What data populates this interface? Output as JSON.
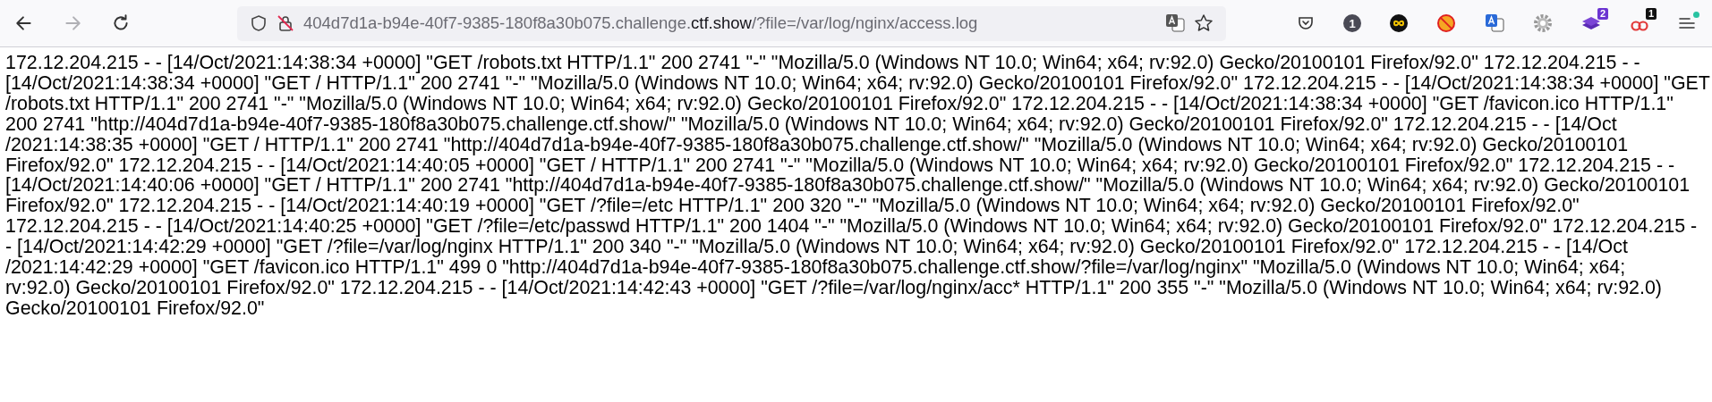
{
  "navigation": [
    {
      "kind": "back",
      "disabled": false
    },
    {
      "kind": "forward",
      "disabled": true
    },
    {
      "kind": "reload",
      "disabled": false
    }
  ],
  "address_bar": {
    "url_host": "404d7d1a-b94e-40f7-9385-180f8a30b075.challenge.",
    "url_domain": "ctf.show",
    "url_path": "/?file=/var/log/nginx/access.log"
  },
  "toolbar_icons": [
    {
      "kind": "pocket"
    },
    {
      "kind": "counter",
      "text": "1"
    },
    {
      "kind": "infinity"
    },
    {
      "kind": "blocked"
    },
    {
      "kind": "translate"
    },
    {
      "kind": "gear"
    },
    {
      "kind": "layers",
      "badge": "2"
    },
    {
      "kind": "rings",
      "badge": "1"
    },
    {
      "kind": "menu",
      "notification": true
    }
  ],
  "log_lines": [
    "172.12.204.215 - - [14/Oct/2021:14:38:34 +0000] \"GET /robots.txt HTTP/1.1\" 200 2741 \"-\" \"Mozilla/5.0 (Windows NT 10.0; Win64; x64; rv:92.0) Gecko/20100101 Firefox/92.0\" 172.12.204.215 - -",
    "[14/Oct/2021:14:38:34 +0000] \"GET / HTTP/1.1\" 200 2741 \"-\" \"Mozilla/5.0 (Windows NT 10.0; Win64; x64; rv:92.0) Gecko/20100101 Firefox/92.0\" 172.12.204.215 - - [14/Oct/2021:14:38:34 +0000] \"GET",
    "/robots.txt HTTP/1.1\" 200 2741 \"-\" \"Mozilla/5.0 (Windows NT 10.0; Win64; x64; rv:92.0) Gecko/20100101 Firefox/92.0\" 172.12.204.215 - - [14/Oct/2021:14:38:34 +0000] \"GET /favicon.ico HTTP/1.1\"",
    "200 2741 \"http://404d7d1a-b94e-40f7-9385-180f8a30b075.challenge.ctf.show/\" \"Mozilla/5.0 (Windows NT 10.0; Win64; x64; rv:92.0) Gecko/20100101 Firefox/92.0\" 172.12.204.215 - - [14/Oct",
    "/2021:14:38:35 +0000] \"GET / HTTP/1.1\" 200 2741 \"http://404d7d1a-b94e-40f7-9385-180f8a30b075.challenge.ctf.show/\" \"Mozilla/5.0 (Windows NT 10.0; Win64; x64; rv:92.0) Gecko/20100101",
    "Firefox/92.0\" 172.12.204.215 - - [14/Oct/2021:14:40:05 +0000] \"GET / HTTP/1.1\" 200 2741 \"-\" \"Mozilla/5.0 (Windows NT 10.0; Win64; x64; rv:92.0) Gecko/20100101 Firefox/92.0\" 172.12.204.215 - -",
    "[14/Oct/2021:14:40:06 +0000] \"GET / HTTP/1.1\" 200 2741 \"http://404d7d1a-b94e-40f7-9385-180f8a30b075.challenge.ctf.show/\" \"Mozilla/5.0 (Windows NT 10.0; Win64; x64; rv:92.0) Gecko/20100101",
    "Firefox/92.0\" 172.12.204.215 - - [14/Oct/2021:14:40:19 +0000] \"GET /?file=/etc HTTP/1.1\" 200 320 \"-\" \"Mozilla/5.0 (Windows NT 10.0; Win64; x64; rv:92.0) Gecko/20100101 Firefox/92.0\"",
    "172.12.204.215 - - [14/Oct/2021:14:40:25 +0000] \"GET /?file=/etc/passwd HTTP/1.1\" 200 1404 \"-\" \"Mozilla/5.0 (Windows NT 10.0; Win64; x64; rv:92.0) Gecko/20100101 Firefox/92.0\" 172.12.204.215 -",
    "- [14/Oct/2021:14:42:29 +0000] \"GET /?file=/var/log/nginx HTTP/1.1\" 200 340 \"-\" \"Mozilla/5.0 (Windows NT 10.0; Win64; x64; rv:92.0) Gecko/20100101 Firefox/92.0\" 172.12.204.215 - - [14/Oct",
    "/2021:14:42:29 +0000] \"GET /favicon.ico HTTP/1.1\" 499 0 \"http://404d7d1a-b94e-40f7-9385-180f8a30b075.challenge.ctf.show/?file=/var/log/nginx\" \"Mozilla/5.0 (Windows NT 10.0; Win64; x64;",
    "rv:92.0) Gecko/20100101 Firefox/92.0\" 172.12.204.215 - - [14/Oct/2021:14:42:43 +0000] \"GET /?file=/var/log/nginx/acc* HTTP/1.1\" 200 355 \"-\" \"Mozilla/5.0 (Windows NT 10.0; Win64; x64; rv:92.0)",
    "Gecko/20100101 Firefox/92.0\""
  ]
}
